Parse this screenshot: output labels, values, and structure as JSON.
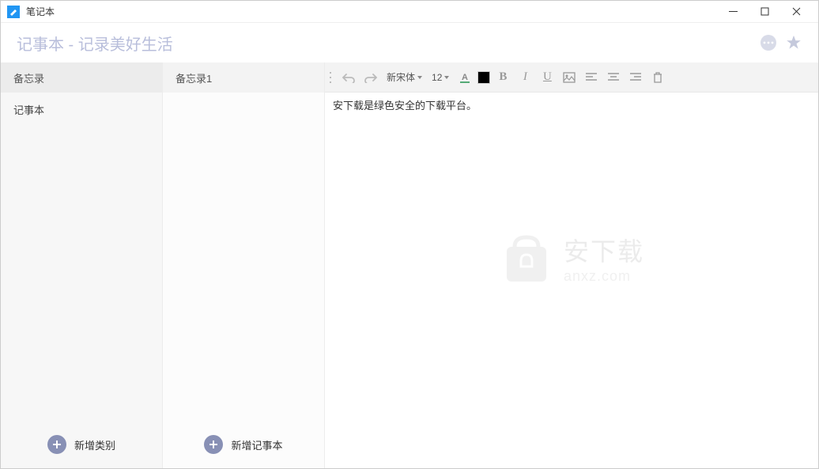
{
  "window": {
    "title": "笔记本"
  },
  "header": {
    "title": "记事本 - 记录美好生活"
  },
  "sidebar1": {
    "header": "备忘录",
    "items": [
      "记事本"
    ],
    "footer": "新增类别"
  },
  "sidebar2": {
    "header": "备忘录1",
    "footer": "新增记事本"
  },
  "toolbar": {
    "font": "新宋体",
    "size": "12"
  },
  "editor": {
    "content": "安下载是绿色安全的下载平台。"
  },
  "watermark": {
    "main": "安下载",
    "sub": "anxz.com"
  }
}
